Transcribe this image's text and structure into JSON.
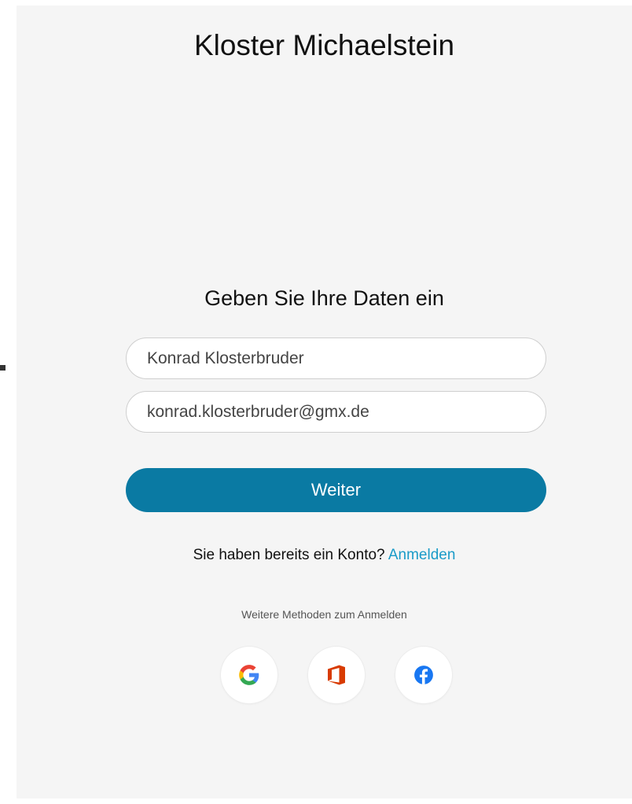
{
  "header": {
    "site_title": "Kloster Michaelstein"
  },
  "form": {
    "heading": "Geben Sie Ihre Daten ein",
    "name_value": "Konrad Klosterbruder",
    "email_value": "konrad.klosterbruder@gmx.de",
    "submit_label": "Weiter",
    "account_prompt": "Sie haben bereits ein Konto?",
    "login_link": "Anmelden"
  },
  "social_login": {
    "heading": "Weitere Methoden zum Anmelden",
    "providers": [
      {
        "icon": "google-icon"
      },
      {
        "icon": "office-icon"
      },
      {
        "icon": "facebook-icon"
      }
    ]
  },
  "colors": {
    "accent": "#0a7aa3",
    "link": "#1a9bc8",
    "panel_background": "#f5f5f5"
  }
}
